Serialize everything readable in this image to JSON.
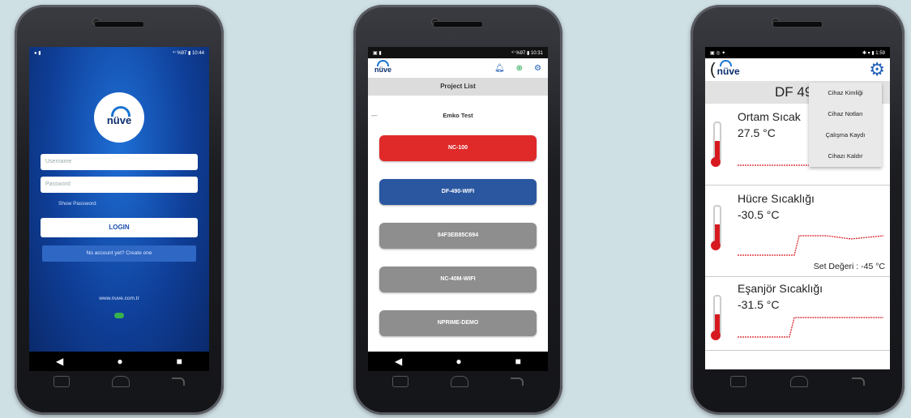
{
  "phone1": {
    "status": {
      "left": "● ▮",
      "right": "⁴⁾ %97 ▮ 10:44"
    },
    "logo_text": "nüve",
    "username_placeholder": "Username",
    "password_placeholder": "Password",
    "show_password": "Show Password",
    "login_label": "LOGIN",
    "create_account": "No account yet? Create one",
    "website": "www.nuve.com.tr"
  },
  "phone2": {
    "status": {
      "left": "▣ ▮",
      "right": "⁴⁾ %97 ▮ 10:31"
    },
    "logo_text": "nüve",
    "header_title": "Project List",
    "project_name": "Emko Test",
    "devices": [
      {
        "label": "NC-100",
        "color": "#e02a2a"
      },
      {
        "label": "DF-490-WIFI",
        "color": "#2a57a0"
      },
      {
        "label": "84F3EB85C694",
        "color": "#8e8e8e"
      },
      {
        "label": "NC-40M-WIFI",
        "color": "#8e8e8e"
      },
      {
        "label": "NPRIME-DEMO",
        "color": "#8e8e8e"
      }
    ]
  },
  "phone3": {
    "status": {
      "left": "▣ ◎ ✦",
      "right": "✱ ▾ ▮ 1:59"
    },
    "logo_text": "nüve",
    "title": "DF 49",
    "menu": [
      "Cihaz Kimliği",
      "Cihaz Notları",
      "Çalışma Kaydı",
      "Cihazı Kaldır"
    ],
    "sensors": [
      {
        "name": "Ortam Sıcak",
        "value": "27.5 °C"
      },
      {
        "name": "Hücre Sıcaklığı",
        "value": "-30.5 °C",
        "setpoint": "Set Değeri : -45 °C"
      },
      {
        "name": "Eşanjör Sıcaklığı",
        "value": "-31.5 °C"
      }
    ]
  },
  "nav": {
    "back": "◀",
    "home": "●",
    "recent": "■"
  }
}
